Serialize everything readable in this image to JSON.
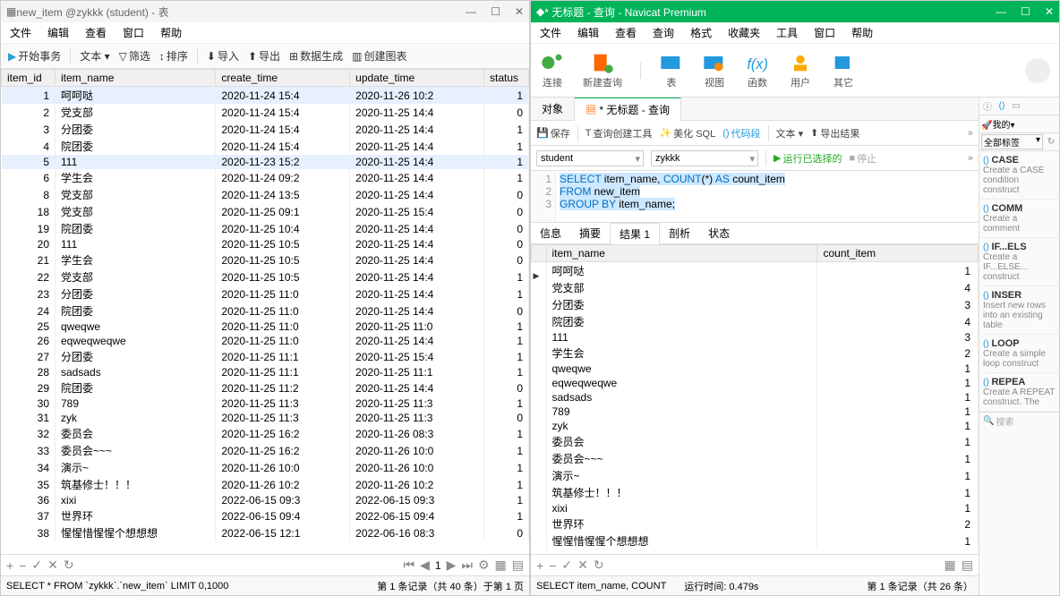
{
  "left": {
    "title": "new_item @zykkk (student) - 表",
    "menus": [
      "文件",
      "编辑",
      "查看",
      "窗口",
      "帮助"
    ],
    "toolbar": {
      "begin": "开始事务",
      "text": "文本 ▾",
      "filter": "筛选",
      "sort": "排序",
      "import": "导入",
      "export": "导出",
      "gen": "数据生成",
      "chart": "创建图表"
    },
    "headers": [
      "item_id",
      "item_name",
      "create_time",
      "update_time",
      "status"
    ],
    "rows": [
      [
        1,
        "呵呵哒",
        "2020-11-24 15:4",
        "2020-11-26 10:2",
        1
      ],
      [
        2,
        "党支部",
        "2020-11-24 15:4",
        "2020-11-25 14:4",
        0
      ],
      [
        3,
        "分团委",
        "2020-11-24 15:4",
        "2020-11-25 14:4",
        1
      ],
      [
        4,
        "院团委",
        "2020-11-24 15:4",
        "2020-11-25 14:4",
        1
      ],
      [
        5,
        "111",
        "2020-11-23 15:2",
        "2020-11-25 14:4",
        1
      ],
      [
        6,
        "学生会",
        "2020-11-24 09:2",
        "2020-11-25 14:4",
        1
      ],
      [
        8,
        "党支部",
        "2020-11-24 13:5",
        "2020-11-25 14:4",
        0
      ],
      [
        18,
        "党支部",
        "2020-11-25 09:1",
        "2020-11-25 15:4",
        0
      ],
      [
        19,
        "院团委",
        "2020-11-25 10:4",
        "2020-11-25 14:4",
        0
      ],
      [
        20,
        "111",
        "2020-11-25 10:5",
        "2020-11-25 14:4",
        0
      ],
      [
        21,
        "学生会",
        "2020-11-25 10:5",
        "2020-11-25 14:4",
        0
      ],
      [
        22,
        "党支部",
        "2020-11-25 10:5",
        "2020-11-25 14:4",
        1
      ],
      [
        23,
        "分团委",
        "2020-11-25 11:0",
        "2020-11-25 14:4",
        1
      ],
      [
        24,
        "院团委",
        "2020-11-25 11:0",
        "2020-11-25 14:4",
        0
      ],
      [
        25,
        "qweqwe",
        "2020-11-25 11:0",
        "2020-11-25 11:0",
        1
      ],
      [
        26,
        "eqweqweqwe",
        "2020-11-25 11:0",
        "2020-11-25 14:4",
        1
      ],
      [
        27,
        "分团委",
        "2020-11-25 11:1",
        "2020-11-25 15:4",
        1
      ],
      [
        28,
        "sadsads",
        "2020-11-25 11:1",
        "2020-11-25 11:1",
        1
      ],
      [
        29,
        "院团委",
        "2020-11-25 11:2",
        "2020-11-25 14:4",
        0
      ],
      [
        30,
        "789",
        "2020-11-25 11:3",
        "2020-11-25 11:3",
        1
      ],
      [
        31,
        "zyk",
        "2020-11-25 11:3",
        "2020-11-25 11:3",
        0
      ],
      [
        32,
        "委员会",
        "2020-11-25 16:2",
        "2020-11-26 08:3",
        1
      ],
      [
        33,
        "委员会~~~",
        "2020-11-25 16:2",
        "2020-11-26 10:0",
        1
      ],
      [
        34,
        "演示~",
        "2020-11-26 10:0",
        "2020-11-26 10:0",
        1
      ],
      [
        35,
        "筑基修士！！！",
        "2020-11-26 10:2",
        "2020-11-26 10:2",
        1
      ],
      [
        36,
        "xixi",
        "2022-06-15 09:3",
        "2022-06-15 09:3",
        1
      ],
      [
        37,
        "世界环",
        "2022-06-15 09:4",
        "2022-06-15 09:4",
        1
      ],
      [
        38,
        "惺惺惜惺惺个想想想",
        "2022-06-15 12:1",
        "2022-06-16 08:3",
        0
      ]
    ],
    "nav": {
      "page": "1"
    },
    "status_sql": "SELECT * FROM `zykkk`.`new_item` LIMIT 0,1000",
    "status_right": "第 1 条记录（共 40 条）于第 1 页"
  },
  "right": {
    "title": "* 无标题 - 查询 - Navicat Premium",
    "menus": [
      "文件",
      "编辑",
      "查看",
      "查询",
      "格式",
      "收藏夹",
      "工具",
      "窗口",
      "帮助"
    ],
    "main_tb": {
      "conn": "连接",
      "newq": "新建查询",
      "table": "表",
      "view": "视图",
      "func": "函数",
      "user": "用户",
      "other": "其它"
    },
    "tabs": {
      "obj": "对象",
      "untitled": "* 无标题 - 查询"
    },
    "qtb": {
      "save": "保存",
      "qbuilder": "查询创建工具",
      "beautify": "美化 SQL",
      "snippet": "代码段",
      "text": "文本 ▾",
      "export": "导出结果",
      "run": "运行已选择的",
      "stop": "停止"
    },
    "conn_combo": "student",
    "db_combo": "zykkk",
    "sql": {
      "l1": "SELECT item_name, COUNT(*) AS count_item",
      "l2": "FROM new_item",
      "l3": "GROUP BY item_name;"
    },
    "result_tabs": [
      "信息",
      "摘要",
      "结果 1",
      "剖析",
      "状态"
    ],
    "result_headers": [
      "item_name",
      "count_item"
    ],
    "result_rows": [
      [
        "呵呵哒",
        1
      ],
      [
        "党支部",
        4
      ],
      [
        "分团委",
        3
      ],
      [
        "院团委",
        4
      ],
      [
        "111",
        3
      ],
      [
        "学生会",
        2
      ],
      [
        "qweqwe",
        1
      ],
      [
        "eqweqweqwe",
        1
      ],
      [
        "sadsads",
        1
      ],
      [
        "789",
        1
      ],
      [
        "zyk",
        1
      ],
      [
        "委员会",
        1
      ],
      [
        "委员会~~~",
        1
      ],
      [
        "演示~",
        1
      ],
      [
        "筑基修士！！！",
        1
      ],
      [
        "xixi",
        1
      ],
      [
        "世界环",
        2
      ],
      [
        "惺惺惜惺惺个想想想",
        1
      ]
    ],
    "status_sql": "SELECT item_name, COUNT",
    "status_time": "运行时间: 0.479s",
    "status_rec": "第 1 条记录（共 26 条）",
    "snippets_header": {
      "combo": "全部标签",
      "mine": "我的"
    },
    "snippets": [
      {
        "t": "CASE",
        "d": "Create a CASE condition construct"
      },
      {
        "t": "COMM",
        "d": "Create a comment"
      },
      {
        "t": "IF...ELS",
        "d": "Create a IF...ELSE... construct"
      },
      {
        "t": "INSER",
        "d": "Insert new rows into an existing table"
      },
      {
        "t": "LOOP",
        "d": "Create a simple loop construct"
      },
      {
        "t": "REPEA",
        "d": "Create A REPEAT construct. The"
      }
    ],
    "search": "搜索"
  }
}
